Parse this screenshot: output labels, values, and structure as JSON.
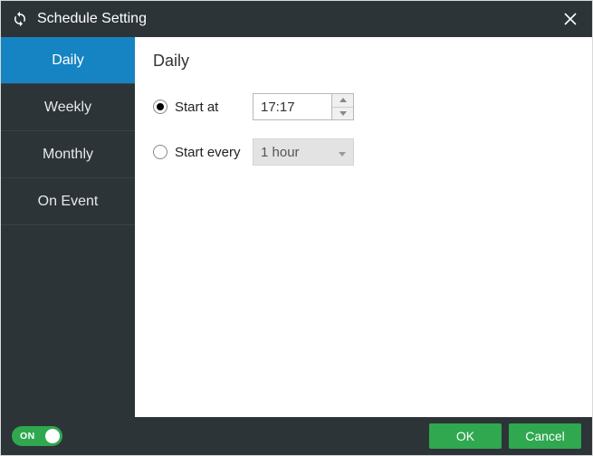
{
  "window": {
    "title": "Schedule Setting"
  },
  "sidebar": {
    "items": [
      {
        "label": "Daily",
        "selected": true
      },
      {
        "label": "Weekly",
        "selected": false
      },
      {
        "label": "Monthly",
        "selected": false
      },
      {
        "label": "On Event",
        "selected": false
      }
    ]
  },
  "panel": {
    "title": "Daily",
    "start_at": {
      "label": "Start at",
      "value": "17:17",
      "selected": true
    },
    "start_every": {
      "label": "Start every",
      "value": "1 hour",
      "selected": false
    }
  },
  "footer": {
    "toggle": {
      "state": "ON"
    },
    "ok": "OK",
    "cancel": "Cancel"
  }
}
